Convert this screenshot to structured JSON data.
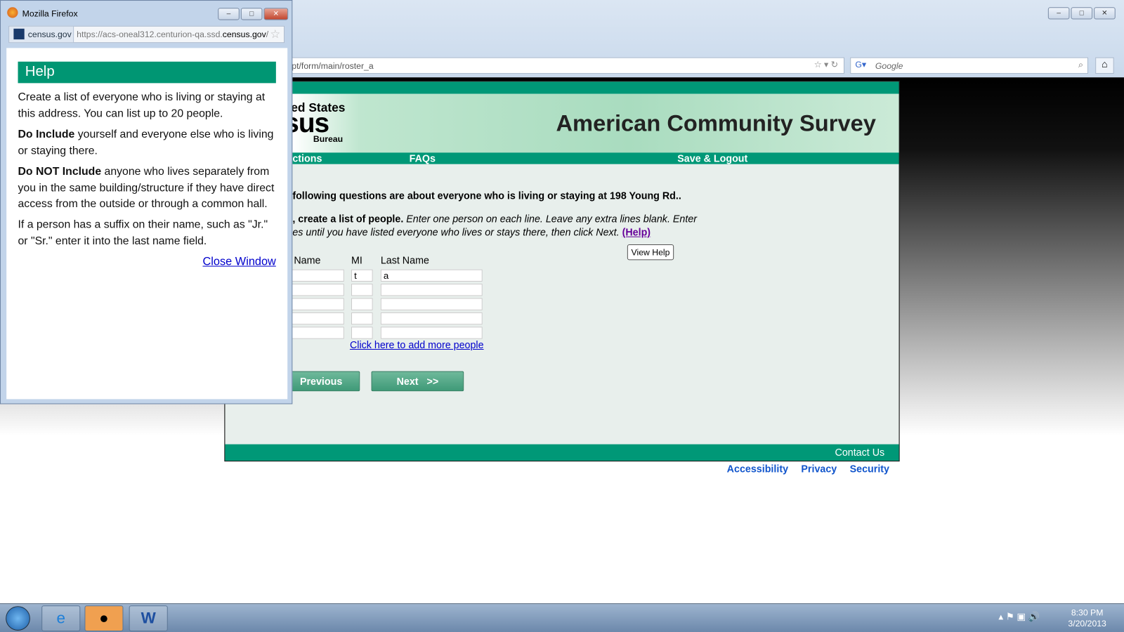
{
  "main_browser": {
    "url": "pt/form/main/roster_a",
    "search_placeholder": "Google"
  },
  "page": {
    "logo_line1": "ed States",
    "logo_line2": "nsus",
    "logo_line3": "Bureau",
    "title": "American Community Survey",
    "nav": [
      "ctions",
      "FAQs",
      "Save & Logout"
    ],
    "intro": "following questions are about everyone who is living or staying at 198 Young Rd..",
    "instr_bold": ", create a list of people.",
    "instr_italic1": "Enter one person on each line. Leave any extra lines blank. Enter",
    "instr_italic2": "es until you have listed everyone who lives or stays there, then click Next.",
    "help_link": "(Help)",
    "view_help": "View Help",
    "columns": [
      "Name",
      "MI",
      "Last Name"
    ],
    "rows": [
      {
        "first": "",
        "mi": "t",
        "last": "a"
      },
      {
        "first": "",
        "mi": "",
        "last": ""
      },
      {
        "first": "",
        "mi": "",
        "last": ""
      },
      {
        "first": "",
        "mi": "",
        "last": ""
      },
      {
        "first": "",
        "mi": "",
        "last": ""
      }
    ],
    "add_more": "Click here to add more people",
    "previous": "Previous",
    "next": "Next   >>",
    "contact": "Contact Us",
    "footer_links": [
      "Accessibility",
      "Privacy",
      "Security"
    ]
  },
  "popup": {
    "window_title": "Mozilla Firefox",
    "site_label": "census.gov",
    "url_prefix": "https://acs-oneal312.centurion-qa.ssd.",
    "url_domain": "census.gov",
    "url_suffix": "/",
    "help_title": "Help",
    "p1": "Create a list of everyone who is living or staying at this address. You can list up to 20 people.",
    "p2_bold": "Do Include",
    "p2": " yourself and everyone else who is living or staying there.",
    "p3_bold": "Do NOT Include",
    "p3": " anyone who lives separately from you in the same building/structure if they have direct access from the outside or through a common hall.",
    "p4": "If a person has a suffix on their name, such as \"Jr.\" or \"Sr.\" enter it into the last name field.",
    "close": "Close Window"
  },
  "taskbar": {
    "time": "8:30 PM",
    "date": "3/20/2013"
  }
}
